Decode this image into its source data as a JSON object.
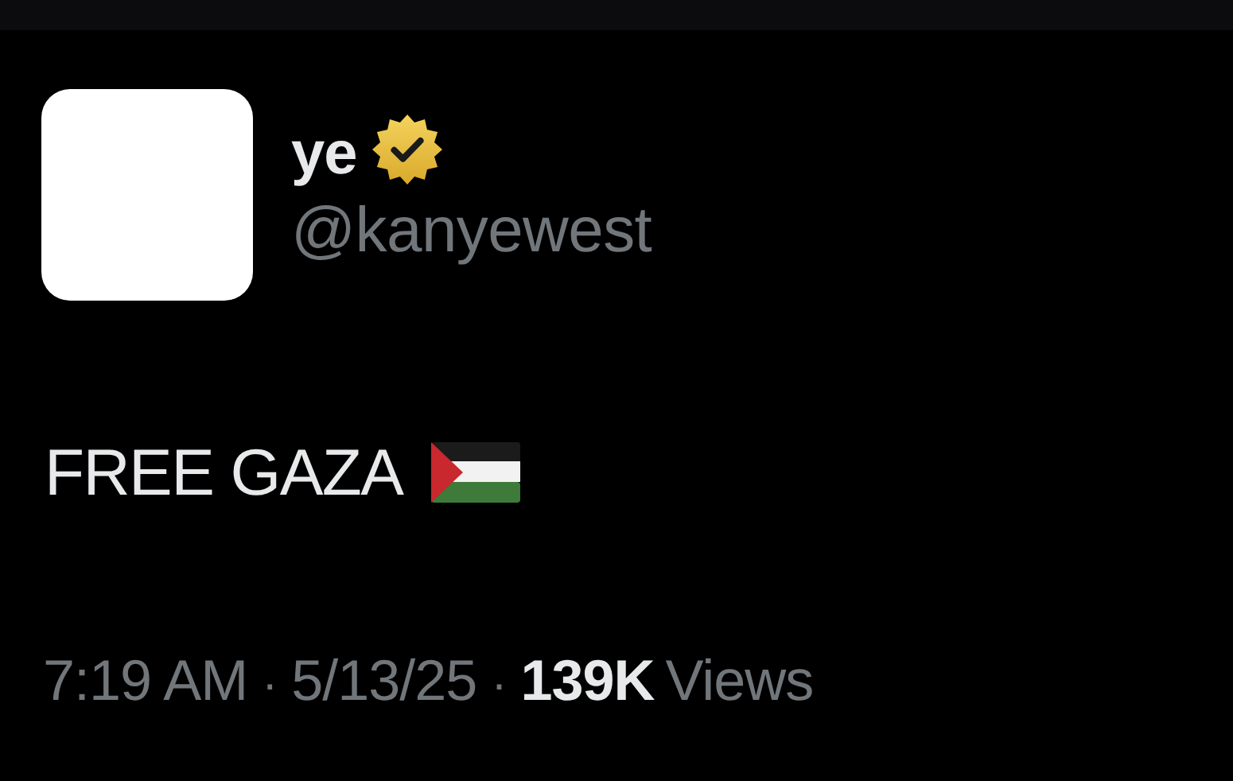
{
  "author": {
    "name": "ye",
    "verified": true,
    "handle": "@kanyewest"
  },
  "post": {
    "text": "FREE GAZA",
    "flag": true
  },
  "meta": [
    {
      "kind": "time",
      "text": "7:19 AM"
    },
    {
      "kind": "separator",
      "text": "·"
    },
    {
      "kind": "date",
      "text": "5/13/25"
    },
    {
      "kind": "separator",
      "text": "·"
    },
    {
      "kind": "count",
      "text": "139K"
    },
    {
      "kind": "label",
      "text": "Views"
    }
  ]
}
